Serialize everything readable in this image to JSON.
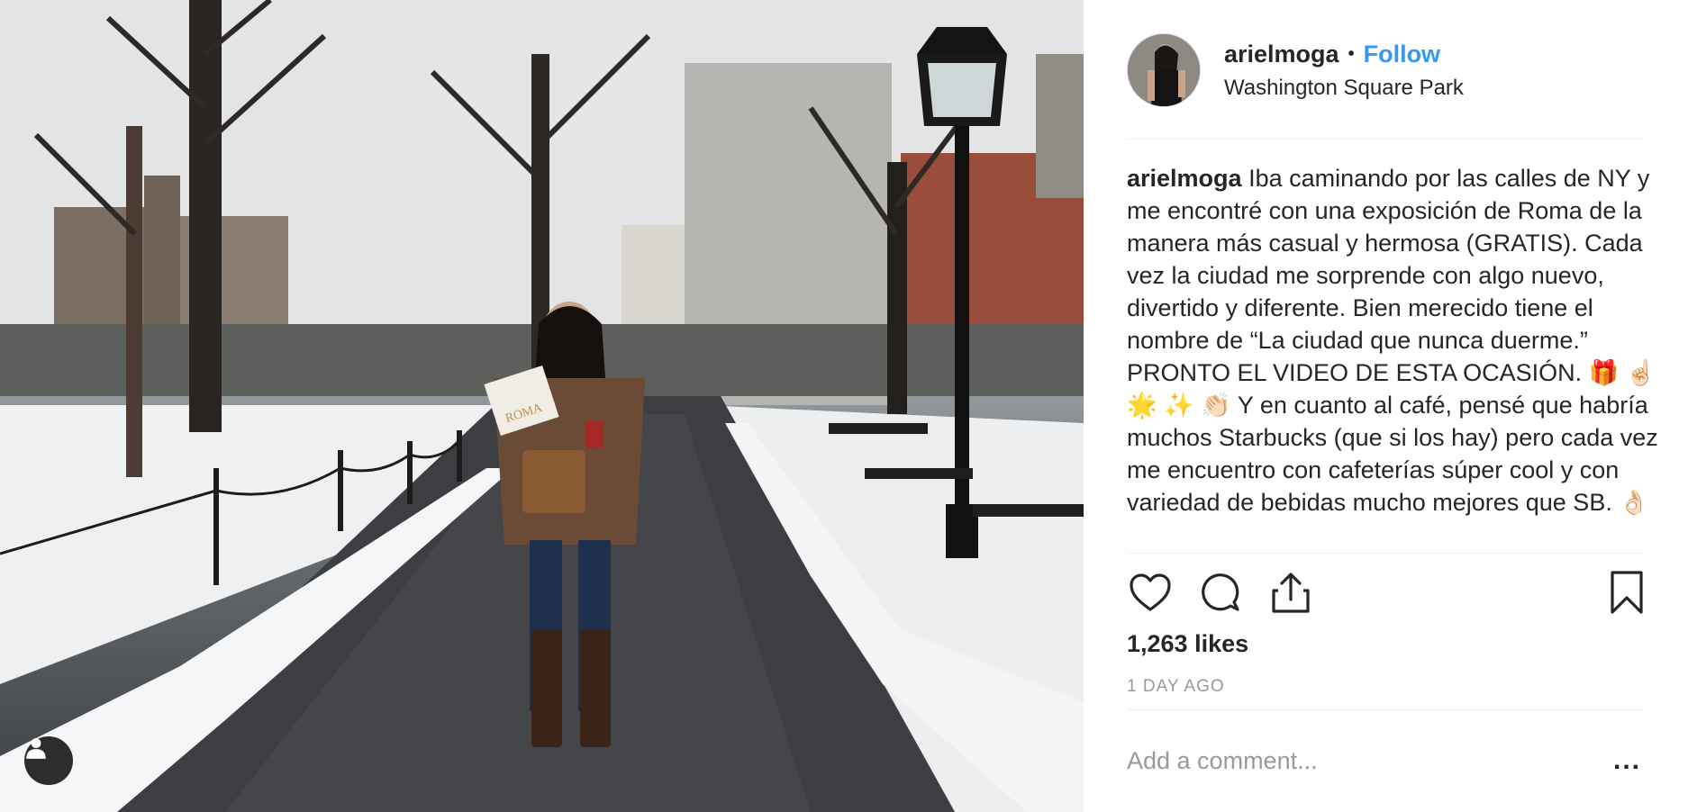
{
  "post": {
    "username": "arielmoga",
    "separator": "•",
    "follow_label": "Follow",
    "location": "Washington Square Park",
    "caption_username": "arielmoga",
    "caption_text": "Iba caminando por las calles de NY y me encontré con una exposición de Roma de la manera más casual y hermosa (GRATIS). Cada vez la ciudad me sorprende con algo nuevo, divertido y diferente. Bien merecido tiene el nombre de “La ciudad que nunca duerme.” PRONTO EL VIDEO DE ESTA OCASIÓN. 🎁 ☝🏻 🌟 ✨ 👏🏻  Y en cuanto al café, pensé que habría muchos Starbucks (que si los hay) pero cada vez me encuentro con cafeterías súper cool y con variedad de bebidas mucho mejores que SB. 👌🏻",
    "likes": "1,263 likes",
    "timestamp": "1 DAY AGO",
    "comment_placeholder": "Add a comment...",
    "more_label": "..."
  },
  "photo": {
    "book_text": "ROMA"
  },
  "icons": {
    "like": "heart-icon",
    "comment": "comment-bubble-icon",
    "share": "share-icon",
    "save": "bookmark-icon",
    "tag": "person-icon"
  },
  "colors": {
    "accent": "#3897f0",
    "text": "#262626",
    "muted": "#999999",
    "divider": "#efefef"
  }
}
